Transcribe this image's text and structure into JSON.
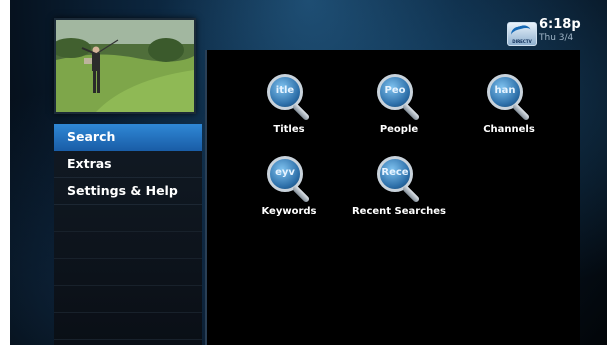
{
  "header": {
    "logo_text": "DIRECTV",
    "time": "6:18p",
    "date": "Thu 3/4"
  },
  "menu": {
    "items": [
      {
        "label": "Search"
      },
      {
        "label": "Extras"
      },
      {
        "label": "Settings & Help"
      }
    ]
  },
  "search": {
    "tiles": [
      {
        "label": "Titles",
        "lens_text": "itle"
      },
      {
        "label": "People",
        "lens_text": "Peo"
      },
      {
        "label": "Channels",
        "lens_text": "han"
      },
      {
        "label": "Keywords",
        "lens_text": "eyv"
      },
      {
        "label": "Recent Searches",
        "lens_text": "Rece"
      }
    ]
  },
  "colors": {
    "accent": "#2f88d6",
    "background": "#06121f"
  }
}
